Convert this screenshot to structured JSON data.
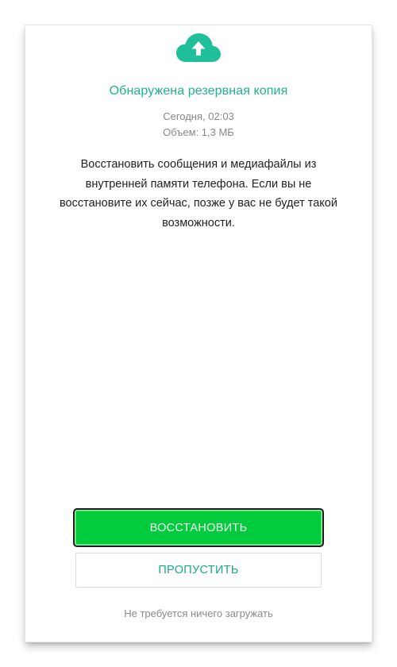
{
  "icon": {
    "name": "cloud-upload-icon",
    "color": "#1fbf9a"
  },
  "backup": {
    "title": "Обнаружена резервная копия",
    "date": "Сегодня, 02:03",
    "size": "Объем: 1,3 МБ"
  },
  "description": "Восстановить сообщения и медиафайлы из внутренней памяти телефона. Если вы не восстановите их сейчас, позже у вас не будет такой возможности.",
  "actions": {
    "restore_label": "ВОССТАНОВИТЬ",
    "skip_label": "ПРОПУСТИТЬ"
  },
  "footer_note": "Не требуется ничего загружать",
  "colors": {
    "accent": "#1fb292",
    "restore_button": "#02cc3c"
  }
}
